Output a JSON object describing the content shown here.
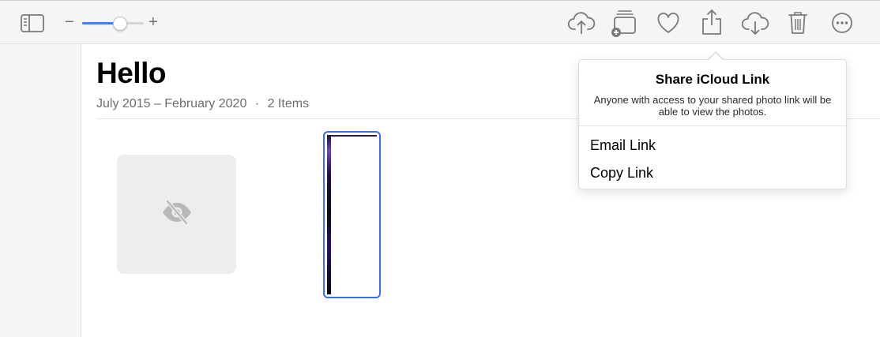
{
  "toolbar": {
    "icons": [
      "sidebar-toggle-icon",
      "upload-icon",
      "add-to-album-icon",
      "heart-icon",
      "share-icon",
      "download-icon",
      "trash-icon",
      "more-icon"
    ],
    "zoom": {
      "minus_label": "−",
      "plus_label": "+",
      "level": 0.6
    },
    "accent_color": "#3b82f6"
  },
  "album": {
    "title": "Hello",
    "date_range": "July 2015 – February 2020",
    "separator": "·",
    "count": "2 Items"
  },
  "photos": [
    {
      "state": "hidden",
      "icon": "eye-slash-icon"
    },
    {
      "state": "selected"
    }
  ],
  "share_popover": {
    "title": "Share iCloud Link",
    "description": "Anyone with access to your shared photo link will be able to view the photos.",
    "items": [
      "Email Link",
      "Copy Link"
    ]
  }
}
